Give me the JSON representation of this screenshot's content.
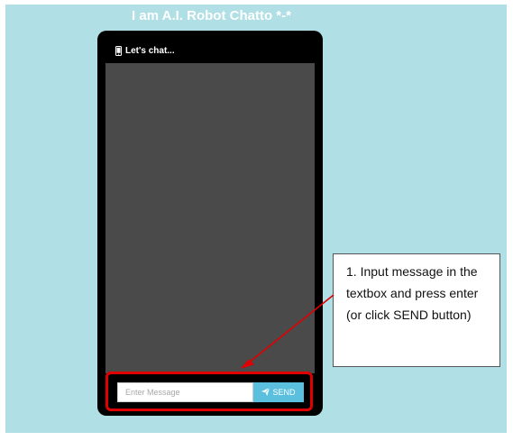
{
  "page": {
    "title": "I am A.I. Robot Chatto *-*"
  },
  "chat_window": {
    "header_label": "Let's chat...",
    "header_icon": "mobile-phone-icon"
  },
  "composer": {
    "placeholder": "Enter Message",
    "value": "",
    "send_label": "SEND",
    "send_icon": "paper-plane-icon"
  },
  "annotation": {
    "text": "1. Input message in the textbox and press enter (or click SEND button)"
  },
  "colors": {
    "page_background": "#b0dfe5",
    "phone_frame": "#000000",
    "chat_area": "#4a4a4a",
    "send_button": "#5bc0de",
    "highlight": "#e00000"
  }
}
